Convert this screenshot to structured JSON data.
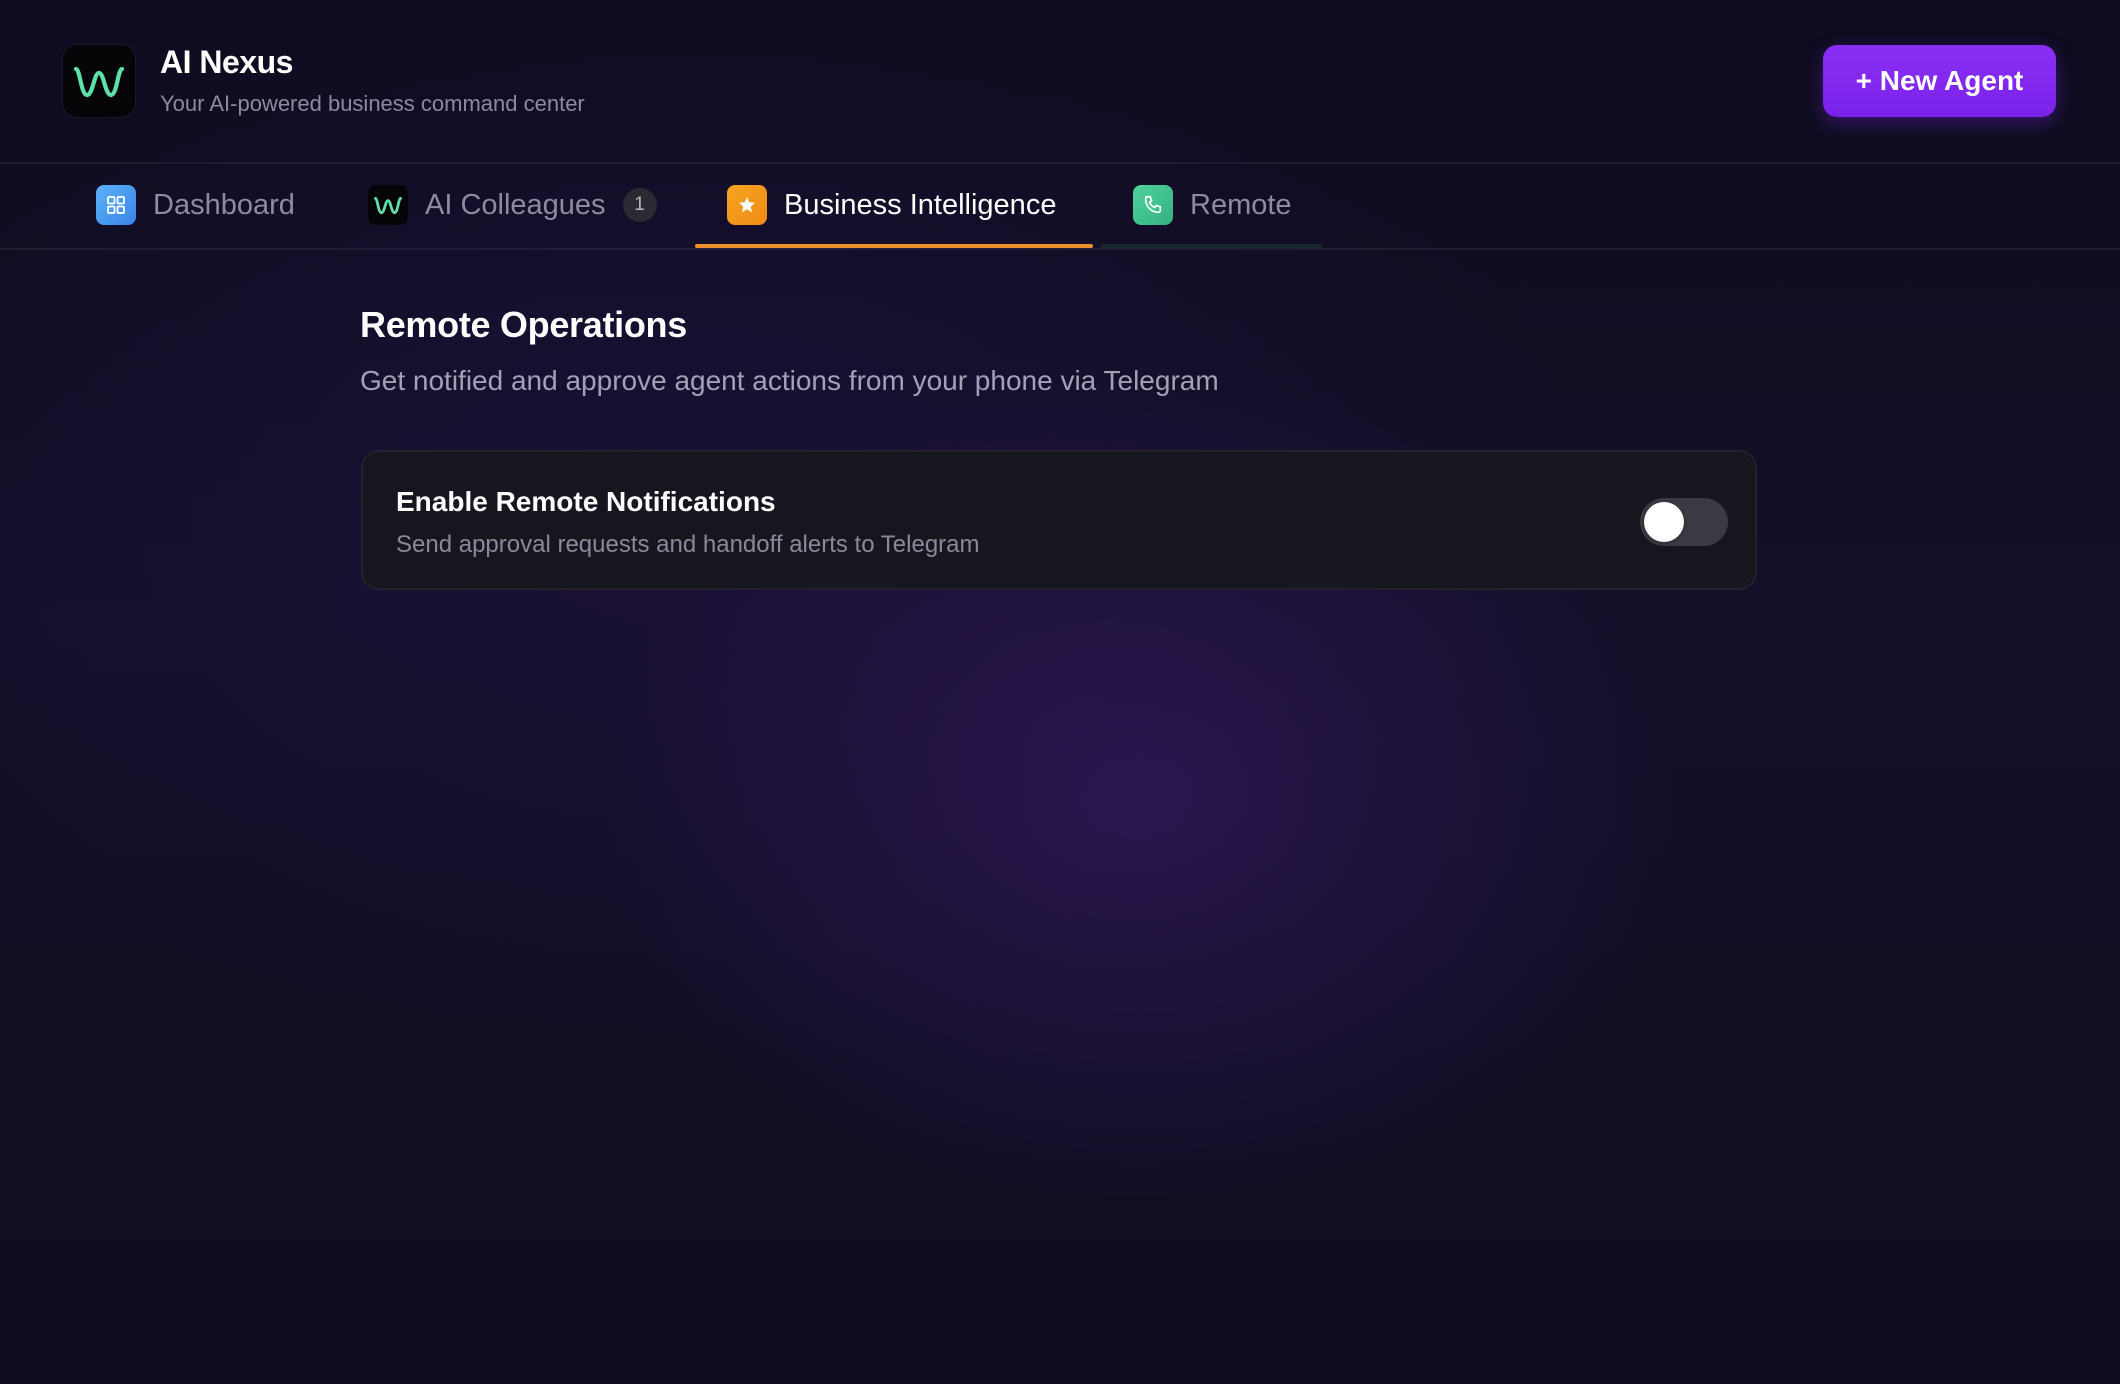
{
  "app": {
    "title": "AI Nexus",
    "subtitle": "Your AI-powered business command center",
    "logo_icon": "waveform-w-icon",
    "logo_color": "#5ee0a8"
  },
  "header": {
    "new_agent_label": "+ New Agent",
    "accent": "#8b2ef5"
  },
  "tabs": [
    {
      "label": "Dashboard",
      "icon": "grid-icon",
      "icon_bg": "#4a9cf0",
      "active": false
    },
    {
      "label": "AI Colleagues",
      "icon": "waveform-w-icon",
      "badge": "1",
      "active": false
    },
    {
      "label": "Business Intelligence",
      "icon": "star-icon",
      "icon_bg": "#f29a1c",
      "active": true
    },
    {
      "label": "Remote",
      "icon": "phone-icon",
      "icon_bg": "#3fbf8e",
      "active": false
    }
  ],
  "active_tab_color": "#e9902b",
  "section": {
    "title": "Remote Operations",
    "subtitle": "Get notified and approve agent actions from your phone via Telegram"
  },
  "remote_card": {
    "title": "Enable Remote Notifications",
    "subtitle": "Send approval requests and handoff alerts to Telegram",
    "enabled": false
  }
}
